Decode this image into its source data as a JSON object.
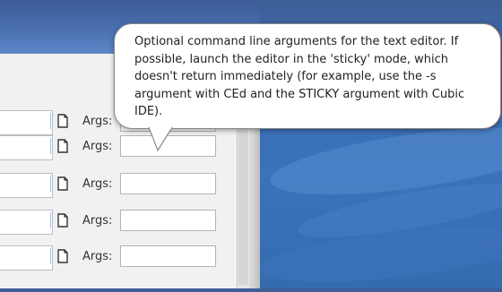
{
  "tooltip": {
    "text": "Optional command line arguments for the text editor. If possible, launch the editor in the 'sticky' mode, which doesn't return immediately (for example, use the -s argument with CEd and the STICKY argument with Cubic IDE)."
  },
  "rows": [
    {
      "path_value": "",
      "args_label": "Args:",
      "args_value": "",
      "file_icon": "document-icon"
    },
    {
      "path_value": "",
      "args_label": "Args:",
      "args_value": "",
      "file_icon": "document-icon"
    },
    {
      "path_value": "",
      "args_label": "Args:",
      "args_value": "",
      "file_icon": "document-icon"
    },
    {
      "path_value": "",
      "args_label": "Args:",
      "args_value": "",
      "file_icon": "document-icon"
    },
    {
      "path_value": "",
      "args_label": "Args:",
      "args_value": "",
      "file_icon": "document-icon"
    }
  ],
  "colors": {
    "desktop": "#3a73bb",
    "titlebar": "#4a6fb1",
    "panel": "#f1f1f1",
    "separator_accent": "#a9c2e6"
  }
}
